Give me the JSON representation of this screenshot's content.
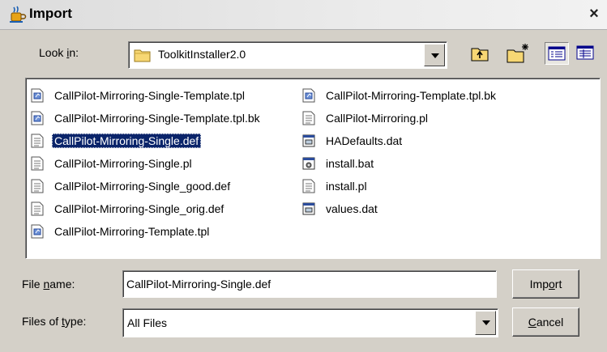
{
  "window": {
    "title": "Import",
    "close_symbol": "×"
  },
  "look_in": {
    "label_pre": "Look ",
    "label_accel": "i",
    "label_post": "n:",
    "value": "ToolkitInstaller2.0",
    "icon": "folder-icon"
  },
  "toolbar": {
    "buttons": [
      {
        "name": "up-one-level-button",
        "icon": "up-folder-icon"
      },
      {
        "name": "create-new-folder-button",
        "icon": "new-folder-icon"
      },
      {
        "name": "list-view-button",
        "icon": "list-view-icon"
      },
      {
        "name": "details-view-button",
        "icon": "details-view-icon"
      }
    ]
  },
  "files": [
    {
      "name": "CallPilot-Mirroring-Single-Template.tpl",
      "icon": "template-file-icon"
    },
    {
      "name": "CallPilot-Mirroring-Single-Template.tpl.bk",
      "icon": "template-file-icon"
    },
    {
      "name": "CallPilot-Mirroring-Single.def",
      "icon": "text-file-icon",
      "selected": true
    },
    {
      "name": "CallPilot-Mirroring-Single.pl",
      "icon": "text-file-icon"
    },
    {
      "name": "CallPilot-Mirroring-Single_good.def",
      "icon": "text-file-icon"
    },
    {
      "name": "CallPilot-Mirroring-Single_orig.def",
      "icon": "text-file-icon"
    },
    {
      "name": "CallPilot-Mirroring-Template.tpl",
      "icon": "template-file-icon"
    },
    {
      "name": "CallPilot-Mirroring-Template.tpl.bk",
      "icon": "template-file-icon"
    },
    {
      "name": "CallPilot-Mirroring.pl",
      "icon": "text-file-icon"
    },
    {
      "name": "HADefaults.dat",
      "icon": "data-file-icon"
    },
    {
      "name": "install.bat",
      "icon": "batch-file-icon"
    },
    {
      "name": "install.pl",
      "icon": "text-file-icon"
    },
    {
      "name": "values.dat",
      "icon": "data-file-icon"
    }
  ],
  "file_name": {
    "label_pre": "File ",
    "label_accel": "n",
    "label_post": "ame:",
    "value": "CallPilot-Mirroring-Single.def"
  },
  "file_type": {
    "label_pre": "Files of ",
    "label_accel": "t",
    "label_post": "ype:",
    "value": "All Files"
  },
  "buttons": {
    "import": {
      "pre": "Imp",
      "accel": "o",
      "post": "rt"
    },
    "cancel": {
      "pre": "",
      "accel": "C",
      "post": "ancel"
    }
  },
  "colors": {
    "selection": "#0a246a",
    "dialog_bg": "#d4d0c8"
  }
}
